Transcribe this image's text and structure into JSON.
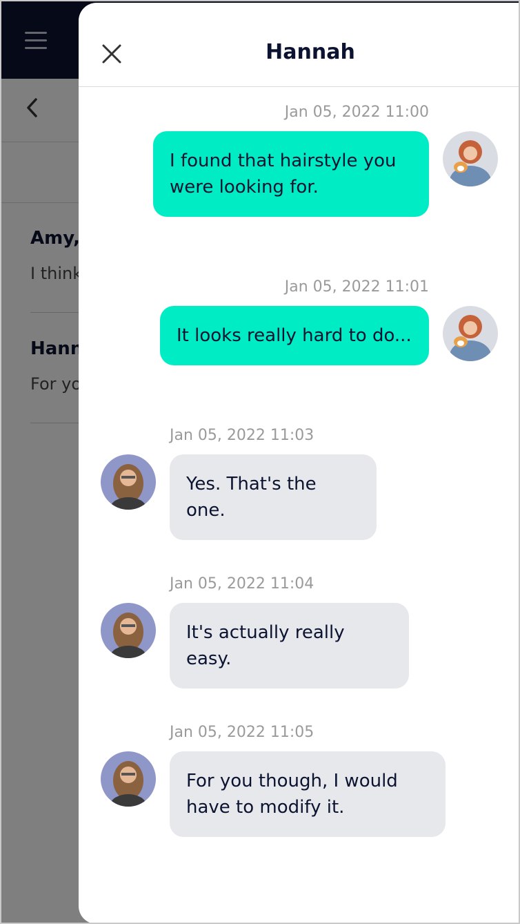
{
  "background": {
    "conversations": [
      {
        "name": "Amy,",
        "preview": "I think"
      },
      {
        "name": "Hann",
        "preview": "For yo"
      }
    ]
  },
  "chat": {
    "title": "Hannah",
    "messages": [
      {
        "direction": "outgoing",
        "time": "Jan 05, 2022 11:00",
        "text": "I found that hairstyle you were looking for."
      },
      {
        "direction": "outgoing",
        "time": "Jan 05, 2022 11:01",
        "text": "It looks really hard to do..."
      },
      {
        "direction": "incoming",
        "time": "Jan 05, 2022 11:03",
        "text": "Yes. That's the one."
      },
      {
        "direction": "incoming",
        "time": "Jan 05, 2022 11:04",
        "text": "It's actually really easy."
      },
      {
        "direction": "incoming",
        "time": "Jan 05, 2022 11:05",
        "text": "For you though, I would have to modify it."
      }
    ]
  },
  "icons": {
    "menu": "hamburger-icon",
    "back": "chevron-left-icon",
    "close": "close-icon"
  },
  "colors": {
    "topbar": "#0c1330",
    "outgoing_bubble": "#00ecc4",
    "incoming_bubble": "#e6e8eb",
    "text_primary": "#0c1330",
    "timestamp": "#9a9a9a"
  }
}
